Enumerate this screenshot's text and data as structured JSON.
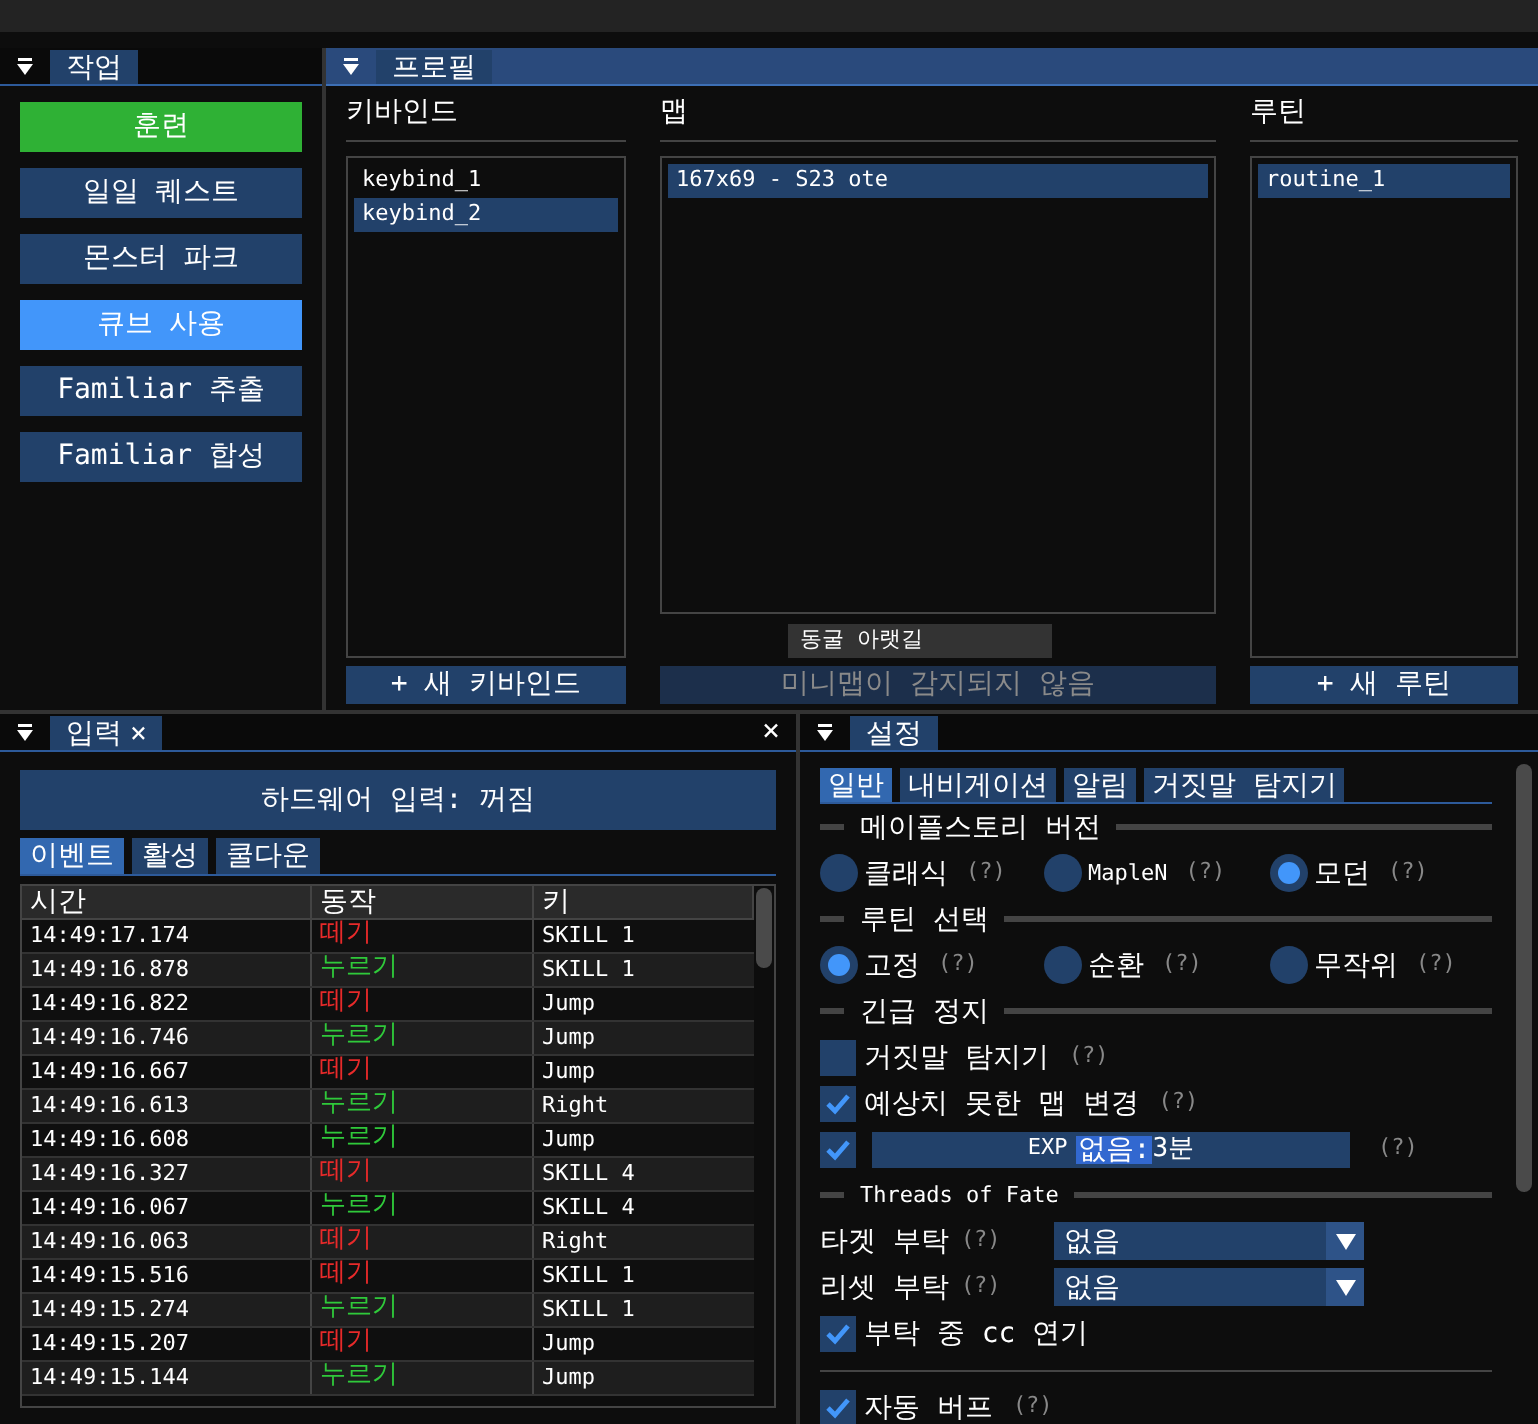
{
  "tasks": {
    "title": "작업",
    "buttons": [
      {
        "label": "훈련",
        "kind": "running"
      },
      {
        "label": "일일 퀘스트",
        "kind": "idle"
      },
      {
        "label": "몬스터 파크",
        "kind": "idle"
      },
      {
        "label": "큐브 사용",
        "kind": "hovered"
      },
      {
        "label": "Familiar 추출",
        "kind": "idle"
      },
      {
        "label": "Familiar 합성",
        "kind": "idle"
      }
    ]
  },
  "profile": {
    "title": "프로필",
    "keybinds": {
      "heading": "키바인드",
      "items": [
        {
          "label": "keybind_1",
          "selected": false
        },
        {
          "label": "keybind_2",
          "selected": true
        }
      ],
      "button": "+ 새 키바인드"
    },
    "maps": {
      "heading": "맵",
      "items": [
        {
          "label": "167x69 - S23 ote",
          "selected": true
        }
      ],
      "tooltip": "동굴 아랫길",
      "button": "미니맵이 감지되지 않음",
      "button_disabled": true
    },
    "routines": {
      "heading": "루틴",
      "items": [
        {
          "label": "routine_1",
          "selected": true
        }
      ],
      "button": "+ 새 루틴"
    }
  },
  "input": {
    "title": "입력",
    "tab_close": "×",
    "close": "×",
    "hardware_button": "하드웨어 입력: 꺼짐",
    "tabs": [
      {
        "label": "이벤트",
        "selected": true
      },
      {
        "label": "활성",
        "selected": false
      },
      {
        "label": "쿨다운",
        "selected": false
      }
    ],
    "columns": [
      "시간",
      "동작",
      "키"
    ],
    "rows": [
      {
        "time": "14:49:17.174",
        "action": "떼기",
        "kind": "release",
        "key": "SKILL 1"
      },
      {
        "time": "14:49:16.878",
        "action": "누르기",
        "kind": "press",
        "key": "SKILL 1"
      },
      {
        "time": "14:49:16.822",
        "action": "떼기",
        "kind": "release",
        "key": "Jump"
      },
      {
        "time": "14:49:16.746",
        "action": "누르기",
        "kind": "press",
        "key": "Jump"
      },
      {
        "time": "14:49:16.667",
        "action": "떼기",
        "kind": "release",
        "key": "Jump"
      },
      {
        "time": "14:49:16.613",
        "action": "누르기",
        "kind": "press",
        "key": "Right"
      },
      {
        "time": "14:49:16.608",
        "action": "누르기",
        "kind": "press",
        "key": "Jump"
      },
      {
        "time": "14:49:16.327",
        "action": "떼기",
        "kind": "release",
        "key": "SKILL 4"
      },
      {
        "time": "14:49:16.067",
        "action": "누르기",
        "kind": "press",
        "key": "SKILL 4"
      },
      {
        "time": "14:49:16.063",
        "action": "떼기",
        "kind": "release",
        "key": "Right"
      },
      {
        "time": "14:49:15.516",
        "action": "떼기",
        "kind": "release",
        "key": "SKILL 1"
      },
      {
        "time": "14:49:15.274",
        "action": "누르기",
        "kind": "press",
        "key": "SKILL 1"
      },
      {
        "time": "14:49:15.207",
        "action": "떼기",
        "kind": "release",
        "key": "Jump"
      },
      {
        "time": "14:49:15.144",
        "action": "누르기",
        "kind": "press",
        "key": "Jump"
      }
    ]
  },
  "settings": {
    "title": "설정",
    "tabs": [
      {
        "label": "일반",
        "selected": true
      },
      {
        "label": "내비게이션",
        "selected": false
      },
      {
        "label": "알림",
        "selected": false
      },
      {
        "label": "거짓말 탐지기",
        "selected": false
      }
    ],
    "items": [
      {
        "kind": "separator",
        "label": "메이플스토리 버전"
      },
      {
        "kind": "radios",
        "options": [
          {
            "label": "클래식",
            "help": "(?)",
            "selected": false
          },
          {
            "label": "MapleN",
            "help": "(?)",
            "selected": false
          },
          {
            "label": "모던",
            "help": "(?)",
            "selected": true
          }
        ]
      },
      {
        "kind": "separator",
        "label": "루틴 선택"
      },
      {
        "kind": "radios",
        "options": [
          {
            "label": "고정",
            "help": "(?)",
            "selected": true
          },
          {
            "label": "순환",
            "help": "(?)",
            "selected": false
          },
          {
            "label": "무작위",
            "help": "(?)",
            "selected": false
          }
        ]
      },
      {
        "kind": "separator",
        "label": "긴급 정지"
      },
      {
        "kind": "checkbox",
        "label": "거짓말 탐지기",
        "help": "(?)",
        "checked": false
      },
      {
        "kind": "checkbox",
        "label": "예상치 못한 맵 변경",
        "help": "(?)",
        "checked": true
      },
      {
        "kind": "checkinput",
        "checked": true,
        "prefix": "EXP",
        "selected_text": "없음:",
        "suffix": "3분",
        "help": "(?)"
      },
      {
        "kind": "separator",
        "label": "Threads of Fate"
      },
      {
        "kind": "dropdown",
        "label": "타겟 부탁",
        "help": "(?)",
        "value": "없음"
      },
      {
        "kind": "dropdown",
        "label": "리셋 부탁",
        "help": "(?)",
        "value": "없음"
      },
      {
        "kind": "checkbox",
        "label": "부탁 중 cc 연기",
        "checked": true
      },
      {
        "kind": "rule"
      },
      {
        "kind": "checkbox",
        "label": "자동 버프",
        "help": "(?)",
        "checked": true
      }
    ]
  }
}
